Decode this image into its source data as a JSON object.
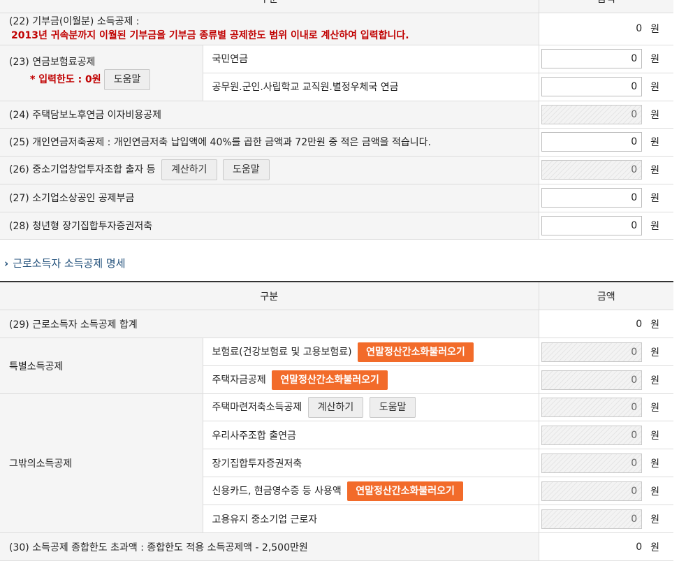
{
  "top_table": {
    "header": {
      "col1": "구분",
      "col2": "금액"
    },
    "rows": {
      "r22": {
        "label": "(22) 기부금(이월분) 소득공제 :",
        "note": "2013년 귀속분까지 이월된 기부금을 기부금 종류별 공제한도 범위 이내로 계산하여 입력합니다.",
        "value": "0",
        "unit": "원"
      },
      "r23": {
        "label": "(23) 연금보험료공제",
        "note": "* 입력한도 : 0원",
        "help": "도움말",
        "sub1": {
          "label": "국민연금",
          "value": "0",
          "unit": "원"
        },
        "sub2": {
          "label": "공무원.군인.사립학교 교직원.별정우체국 연금",
          "value": "0",
          "unit": "원"
        }
      },
      "r24": {
        "label": "(24) 주택담보노후연금 이자비용공제",
        "value": "0",
        "unit": "원"
      },
      "r25": {
        "label": "(25) 개인연금저축공제 : 개인연금저축 납입액에 40%를 곱한 금액과 72만원 중 적은 금액을 적습니다.",
        "value": "0",
        "unit": "원"
      },
      "r26": {
        "label": "(26) 중소기업창업투자조합 출자 등",
        "calc": "계산하기",
        "help": "도움말",
        "value": "0",
        "unit": "원"
      },
      "r27": {
        "label": "(27) 소기업소상공인 공제부금",
        "value": "0",
        "unit": "원"
      },
      "r28": {
        "label": "(28) 청년형 장기집합투자증권저축",
        "value": "0",
        "unit": "원"
      }
    }
  },
  "section_title": "근로소득자 소득공제 명세",
  "bottom_table": {
    "header": {
      "col1": "구분",
      "col2": "금액"
    },
    "r29": {
      "label": "(29) 근로소득자 소득공제 합계",
      "value": "0",
      "unit": "원"
    },
    "special": {
      "label": "특별소득공제",
      "sub1": {
        "label": "보험료(건강보험료 및 고용보험료)",
        "action": "연말정산간소화불러오기",
        "value": "0",
        "unit": "원"
      },
      "sub2": {
        "label": "주택자금공제",
        "action": "연말정산간소화불러오기",
        "value": "0",
        "unit": "원"
      }
    },
    "other": {
      "label": "그밖의소득공제",
      "sub1": {
        "label": "주택마련저축소득공제",
        "calc": "계산하기",
        "help": "도움말",
        "value": "0",
        "unit": "원"
      },
      "sub2": {
        "label": "우리사주조합 출연금",
        "value": "0",
        "unit": "원"
      },
      "sub3": {
        "label": "장기집합투자증권저축",
        "value": "0",
        "unit": "원"
      },
      "sub4": {
        "label": "신용카드, 현금영수증 등 사용액",
        "action": "연말정산간소화불러오기",
        "value": "0",
        "unit": "원"
      },
      "sub5": {
        "label": "고용유지 중소기업 근로자",
        "value": "0",
        "unit": "원"
      }
    },
    "r30": {
      "label": "(30) 소득공제 종합한도 초과액 : 종합한도 적용 소득공제액 - 2,500만원",
      "value": "0",
      "unit": "원"
    }
  }
}
